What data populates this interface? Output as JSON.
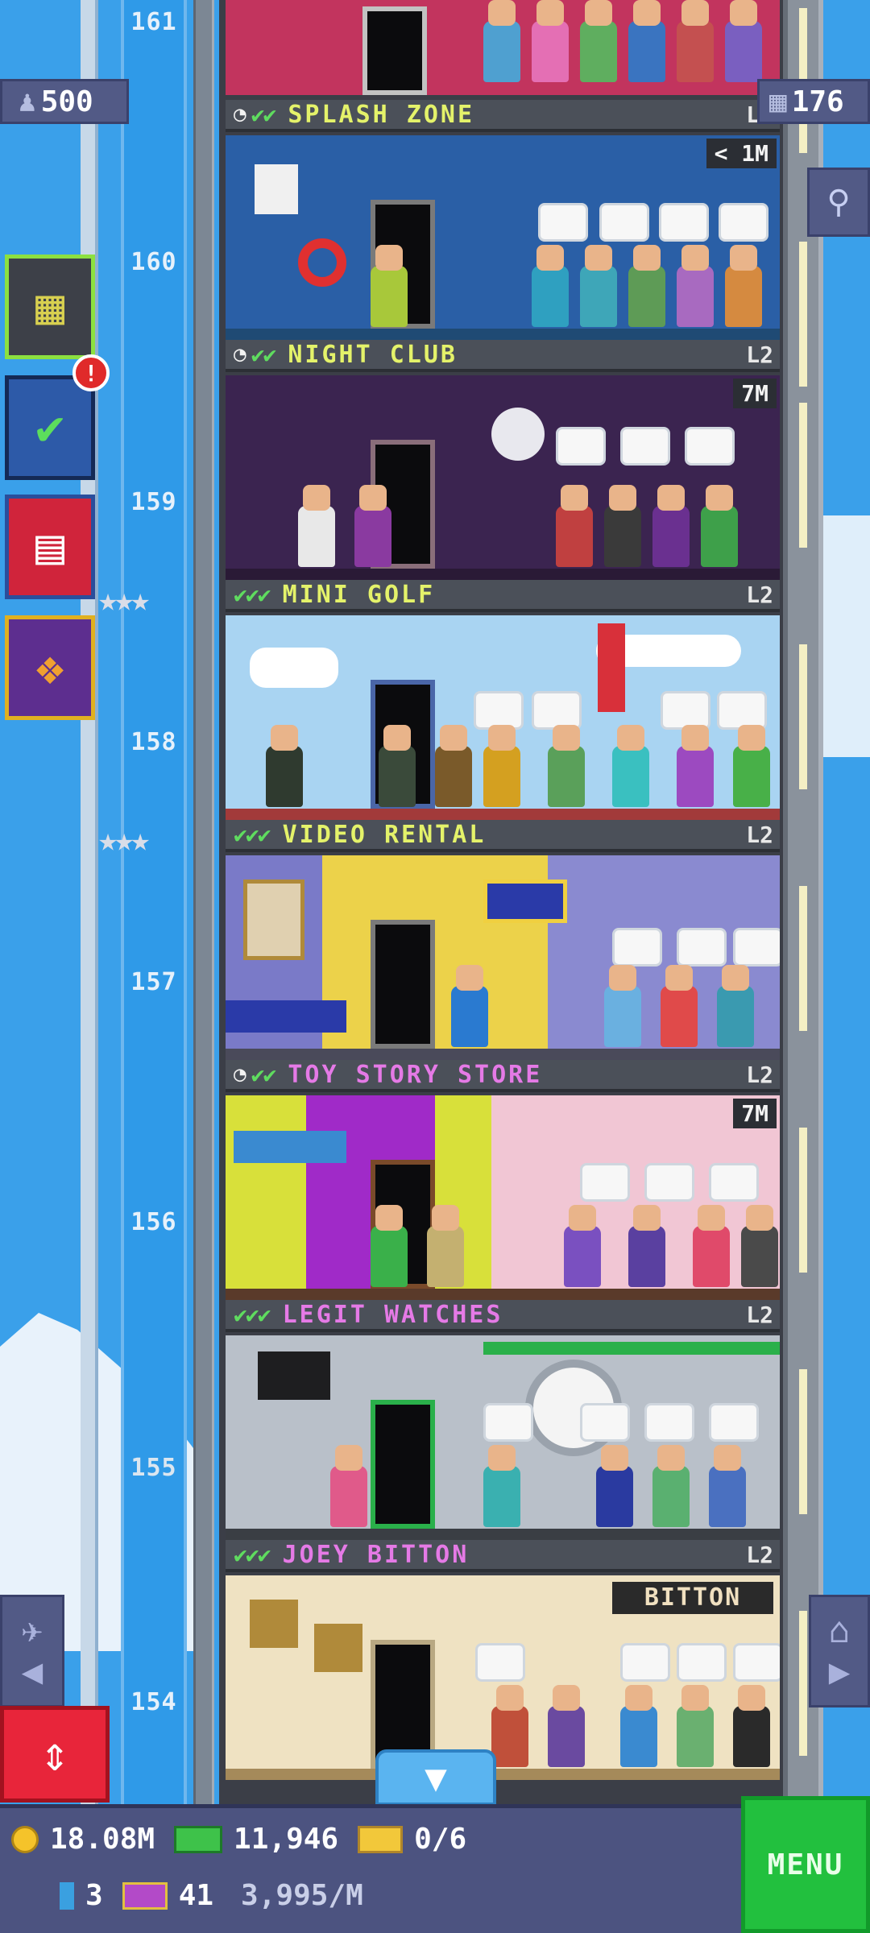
{
  "header": {
    "population": "500",
    "storeys": "176"
  },
  "floor_numbers": [
    "161",
    "160",
    "159",
    "158",
    "157",
    "156",
    "155",
    "154"
  ],
  "floors": [
    {
      "name": "SPLASH ZONE",
      "status_icons": "✔✔",
      "timer": true,
      "level": "L2",
      "badge": "< 1M",
      "name_color": "#e4f26a"
    },
    {
      "name": "NIGHT CLUB",
      "status_icons": "✔✔",
      "timer": true,
      "level": "L2",
      "badge": "7M",
      "name_color": "#e4f26a"
    },
    {
      "name": "MINI GOLF",
      "status_icons": "✔✔✔",
      "timer": false,
      "level": "L2",
      "badge": "",
      "name_color": "#e4f26a"
    },
    {
      "name": "VIDEO RENTAL",
      "status_icons": "✔✔✔",
      "timer": false,
      "level": "L2",
      "badge": "",
      "name_color": "#e4f26a"
    },
    {
      "name": "TOY STORY STORE",
      "status_icons": "✔✔",
      "timer": true,
      "level": "L2",
      "badge": "7M",
      "name_color": "#e57ae6"
    },
    {
      "name": "LEGIT WATCHES",
      "status_icons": "✔✔✔",
      "timer": false,
      "level": "L2",
      "badge": "",
      "name_color": "#e57ae6"
    },
    {
      "name": "JOEY BITTON",
      "status_icons": "✔✔✔",
      "timer": false,
      "level": "L2",
      "badge": "",
      "name_color": "#e57ae6",
      "sign": "BITTON"
    }
  ],
  "side_buttons": {
    "tasks_alert": "!"
  },
  "hud": {
    "coins": "18.08M",
    "bux": "11,946",
    "tickets": "0/6",
    "keys": "3",
    "vip": "41",
    "rate": "3,995/M",
    "menu_label": "MENU"
  },
  "icons": {
    "population": "person-icon",
    "storeys": "building-grid-icon",
    "search": "magnifier-icon",
    "elevator": "up-down-arrows-icon"
  }
}
